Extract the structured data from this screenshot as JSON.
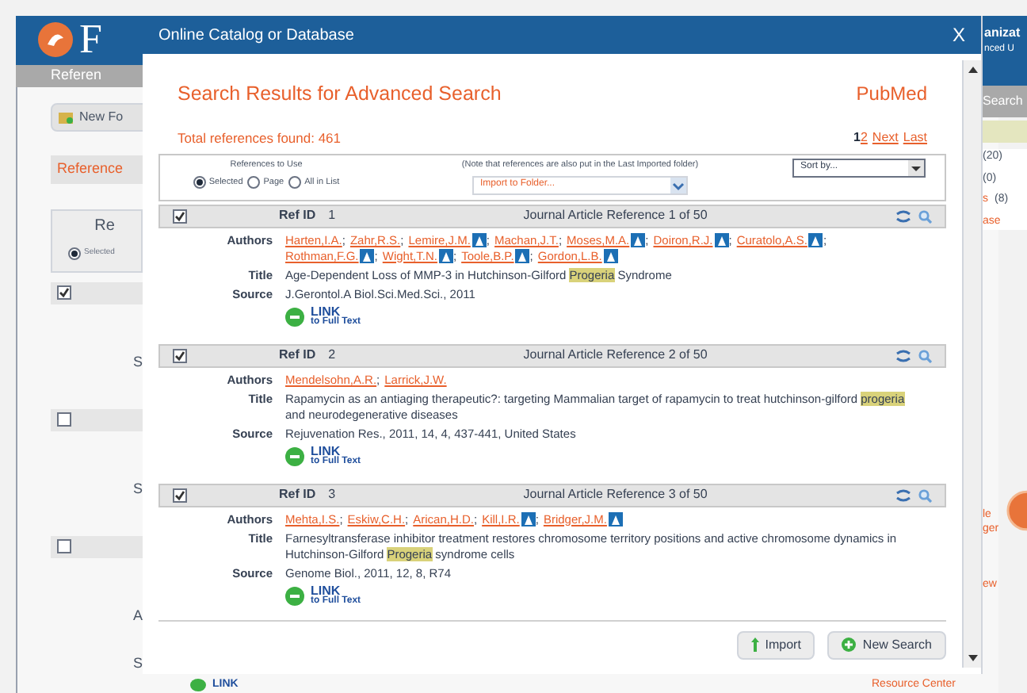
{
  "background": {
    "logo_letter": "F",
    "tab": "Referen",
    "new_folder": "New Fo",
    "references": "Reference",
    "box_title": "Re",
    "radio": {
      "label": "Selected",
      "selected": true
    },
    "rows": [
      {
        "checked": true,
        "letter": "S"
      },
      {
        "checked": false,
        "letter": "S"
      },
      {
        "checked": false,
        "letter": "A"
      }
    ],
    "last_letter": "S",
    "org_lines": [
      "anizat",
      "nced U"
    ],
    "search_tab": "Search",
    "counts": [
      {
        "count": "(20)"
      },
      {
        "count": "(0)"
      },
      {
        "label": "s",
        "count": "(8)"
      },
      {
        "label": "ase"
      }
    ],
    "side_text": [
      "le",
      "ger"
    ],
    "view": "ew",
    "bottom_link": "LINK",
    "resource": "Resource Center"
  },
  "dialog": {
    "title": "Online Catalog or Database",
    "close": "X",
    "heading": "Search Results for Advanced Search",
    "database": "PubMed",
    "total": "Total references found: 461",
    "pages": [
      {
        "label": "1",
        "selected": true
      },
      {
        "label": "2",
        "selected": false
      },
      {
        "label": "Next",
        "selected": false
      },
      {
        "label": "Last",
        "selected": false
      }
    ],
    "refs_label": "References to Use",
    "radios": [
      {
        "label": "Selected",
        "selected": true
      },
      {
        "label": "Page",
        "selected": false
      },
      {
        "label": "All in List",
        "selected": false
      }
    ],
    "author_separator": ";",
    "note": "(Note that references are also put in the Last Imported folder)",
    "folder": "Import to Folder...",
    "sort": "Sort by...",
    "references": [
      {
        "checked": true,
        "id_label": "Ref ID",
        "id": "1",
        "type": "Journal Article Reference 1 of 50",
        "labels": [
          "Authors",
          "Title",
          "Source"
        ],
        "authors": [
          {
            "name": "Harten,I.A.",
            "icon": false
          },
          {
            "name": "Zahr,R.S.",
            "icon": false
          },
          {
            "name": "Lemire,J.M.",
            "icon": true
          },
          {
            "name": "Machan,J.T.",
            "icon": false
          },
          {
            "name": "Moses,M.A.",
            "icon": true
          },
          {
            "name": "Doiron,R.J.",
            "icon": true
          },
          {
            "name": "Curatolo,A.S.",
            "icon": true
          },
          {
            "name": "Rothman,F.G.",
            "icon": true
          },
          {
            "name": "Wight,T.N.",
            "icon": true
          },
          {
            "name": "Toole,B.P.",
            "icon": true
          },
          {
            "name": "Gordon,L.B.",
            "icon": true
          }
        ],
        "title": [
          {
            "text": "Age-Dependent Loss of MMP-3 in Hutchinson-Gilford ",
            "highlighted": false
          },
          {
            "text": "Progeria",
            "highlighted": true
          },
          {
            "text": " Syndrome",
            "highlighted": false
          }
        ],
        "source": "J.Gerontol.A Biol.Sci.Med.Sci., 2011",
        "link": [
          "LINK",
          "to Full Text"
        ]
      },
      {
        "checked": true,
        "id_label": "Ref ID",
        "id": "2",
        "type": "Journal Article Reference 2 of 50",
        "labels": [
          "Authors",
          "Title",
          "Source"
        ],
        "authors": [
          {
            "name": "Mendelsohn,A.R.",
            "icon": false
          },
          {
            "name": "Larrick,J.W.",
            "icon": false
          }
        ],
        "title": [
          {
            "text": "Rapamycin as an antiaging therapeutic?: targeting Mammalian target of rapamycin to treat hutchinson-gilford ",
            "highlighted": false
          },
          {
            "text": "progeria",
            "highlighted": true
          },
          {
            "text": " and neurodegenerative diseases",
            "highlighted": false
          }
        ],
        "source": "Rejuvenation Res., 2011, 14, 4, 437-441, United States",
        "link": [
          "LINK",
          "to Full Text"
        ]
      },
      {
        "checked": true,
        "id_label": "Ref ID",
        "id": "3",
        "type": "Journal Article Reference 3 of 50",
        "labels": [
          "Authors",
          "Title",
          "Source"
        ],
        "authors": [
          {
            "name": "Mehta,I.S.",
            "icon": false
          },
          {
            "name": "Eskiw,C.H.",
            "icon": false
          },
          {
            "name": "Arican,H.D.",
            "icon": false
          },
          {
            "name": "Kill,I.R.",
            "icon": true
          },
          {
            "name": "Bridger,J.M.",
            "icon": true
          }
        ],
        "title": [
          {
            "text": "Farnesyltransferase inhibitor treatment restores chromosome territory positions and active chromosome dynamics in Hutchinson-Gilford ",
            "highlighted": false
          },
          {
            "text": "Progeria",
            "highlighted": true
          },
          {
            "text": " syndrome cells",
            "highlighted": false
          }
        ],
        "source": "Genome Biol., 2011, 12, 8, R74",
        "link": [
          "LINK",
          "to Full Text"
        ]
      }
    ],
    "buttons": [
      {
        "kind": "import",
        "label": "Import"
      },
      {
        "kind": "new",
        "label": "New Search"
      }
    ]
  }
}
